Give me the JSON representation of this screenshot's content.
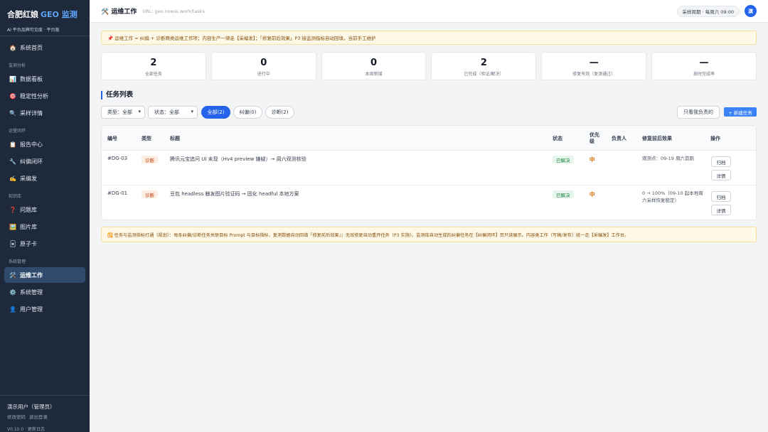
{
  "brand": {
    "name": "合肥红娘",
    "accent": "GEO 监测",
    "subtitle": "AI 平台品牌可见度 · 平台版"
  },
  "sidebar": {
    "home": {
      "icon": "🏠",
      "label": "系统首页"
    },
    "group_monitor": "监测分析",
    "dashboard": {
      "icon": "📊",
      "label": "数据看板"
    },
    "stability": {
      "icon": "🎯",
      "label": "稳定性分析"
    },
    "sampling": {
      "icon": "🔍",
      "label": "采样详情"
    },
    "group_ops": "运营闭环",
    "reports": {
      "icon": "📋",
      "label": "报告中心"
    },
    "correction": {
      "icon": "🔧",
      "label": "纠偏闭环"
    },
    "publish": {
      "icon": "✍️",
      "label": "采编发"
    },
    "group_knowledge": "知识库",
    "questions": {
      "icon": "❓",
      "label": "问题库"
    },
    "images": {
      "icon": "🖼️",
      "label": "图片库"
    },
    "atoms": {
      "icon": "🃏",
      "label": "原子卡"
    },
    "group_system": "系统管理",
    "ops": {
      "icon": "🛠️",
      "label": "运维工作"
    },
    "sysadmin": {
      "icon": "⚙️",
      "label": "系统管理"
    },
    "users": {
      "icon": "👤",
      "label": "用户管理"
    },
    "user_name": "演示用户（管理员）",
    "change_password": "修改密码",
    "logout": "退出登录",
    "version": "V0.10.0 · 更新日志"
  },
  "topbar": {
    "icon": "🛠️",
    "title": "运维工作",
    "url": "URL: geo.nowai.work/tasks",
    "period": "采样周期 · 每周六 09:00",
    "avatar": "演"
  },
  "notice": "📌 运维工作 = 纠偏 + 诊断两类运维工作项；内容生产一律走【采编发】；「修复前后效果」P3 接监测指标自动回填，当前手工维护",
  "stats": [
    {
      "value": "2",
      "label": "全部任务"
    },
    {
      "value": "0",
      "label": "进行中"
    },
    {
      "value": "0",
      "label": "本周新增"
    },
    {
      "value": "2",
      "label": "已完成（验证/解决）"
    },
    {
      "value": "—",
      "label": "修复有效（复测通过）"
    },
    {
      "value": "—",
      "label": "按时完成率"
    }
  ],
  "section_title": "任务列表",
  "filters": {
    "type_select": "类型：全部",
    "status_select": "状态：全部",
    "tab_all": "全部(2)",
    "tab_correction": "纠偏(0)",
    "tab_diagnosis": "诊断(2)",
    "mine_button": "只看我负责的",
    "new_button": "+ 新建任务"
  },
  "table": {
    "headers": {
      "id": "编号",
      "type": "类型",
      "title": "标题",
      "status": "状态",
      "priority_line1": "优先",
      "priority_line2": "级",
      "owner": "负责人",
      "effect": "修复前后效果",
      "actions": "操作"
    },
    "rows": [
      {
        "id": "#DG-03",
        "type": "诊断",
        "title": "腾讯元宝追问 UI 未现（Hv4 preview 嫌疑）→ 周六观测核验",
        "status": "已解决",
        "priority": "中",
        "owner": "",
        "effect": "观测点：09-19 周六首跑",
        "action_archive": "归档",
        "action_detail": "详情"
      },
      {
        "id": "#DG-01",
        "type": "诊断",
        "title": "豆包 headless 触发图片验证码 → 固化 headful 本地方案",
        "status": "已解决",
        "priority": "中",
        "owner": "",
        "effect": "0 → 100%（09-10 起本地周六采样恢复稳定）",
        "action_archive": "归档",
        "action_detail": "详情"
      }
    ]
  },
  "footnote": "🔁 任务与监测指标打通（规划）：每条纠偏/诊断任务关联目标 Prompt 与目标指标，复测数据自动回填「修复前后效果」；无效修复自动重开任务（P3 实施）。监测库自动生成的纠偏任务在【纠偏闭环】页只读展示。内容类工作（写稿/发布）统一走【采编发】工作台。",
  "colors": {
    "sidebar_bg": "#1e2a3b",
    "accent": "#2563eb",
    "active_nav": "#2f4a6d",
    "notice_bg": "#fef9e7"
  }
}
